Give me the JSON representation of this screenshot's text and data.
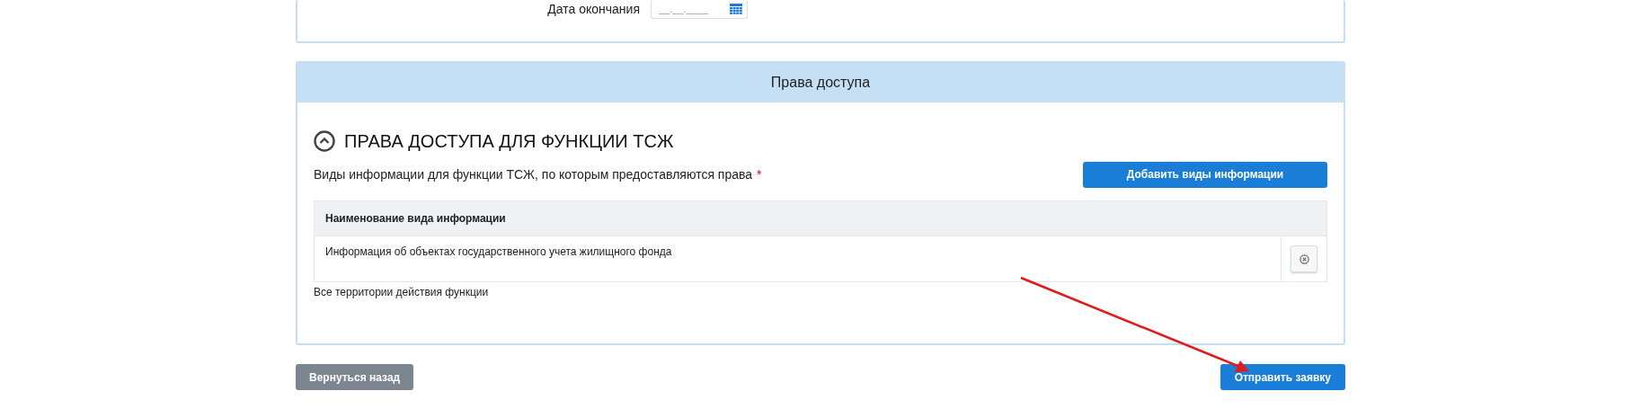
{
  "date_field": {
    "label": "Дата окончания",
    "placeholder": "__.__.____"
  },
  "access_panel": {
    "header": "Права доступа",
    "section_title": "ПРАВА ДОСТУПА ДЛЯ ФУНКЦИИ ТСЖ",
    "expanded": true,
    "field_label": "Виды информации для функции ТСЖ, по которым предоставляются права",
    "required_mark": "*",
    "add_button": "Добавить виды информации",
    "table": {
      "columns": [
        "Наименование вида информации"
      ],
      "rows": [
        {
          "name": "Информация об объектах государственного учета жилищного фонда"
        }
      ]
    },
    "note": "Все территории действия функции"
  },
  "buttons": {
    "back": "Вернуться назад",
    "submit": "Отправить заявку"
  }
}
